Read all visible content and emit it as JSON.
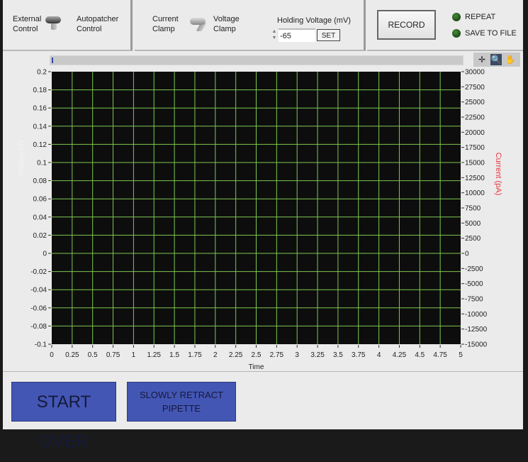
{
  "control_mode": {
    "left_label": "External\nControl",
    "left_line1": "External",
    "left_line2": "Control",
    "right_line1": "Autopatcher",
    "right_line2": "Control",
    "state": "External Control"
  },
  "clamp_mode": {
    "left_line1": "Current",
    "left_line2": "Clamp",
    "right_line1": "Voltage",
    "right_line2": "Clamp",
    "state": "Voltage Clamp"
  },
  "holding_voltage": {
    "label": "Holding Voltage (mV)",
    "value": "-65",
    "set_label": "SET"
  },
  "record": {
    "label": "RECORD"
  },
  "indicators": [
    {
      "label": "REPEAT",
      "state": "off",
      "color": "#2e6b22"
    },
    {
      "label": "SAVE TO FILE",
      "state": "off",
      "color": "#2e6b22"
    }
  ],
  "graph_palette": [
    {
      "icon": "cursor-crosshair-icon",
      "glyph": "✛"
    },
    {
      "icon": "zoom-icon",
      "glyph": "🔍"
    },
    {
      "icon": "pan-hand-icon",
      "glyph": "✋"
    }
  ],
  "buttons": {
    "start_over": "START OVER",
    "retract_line1": "SLOWLY RETRACT",
    "retract_line2": "PIPETTE"
  },
  "colors": {
    "plot_bg": "#0d0d0d",
    "grid": "#7ec850",
    "current_axis_label": "#e8323c",
    "button_blue": "#4356b4"
  },
  "chart_data": {
    "type": "line",
    "title": "",
    "xlabel": "Time",
    "ylabel": "Voltage (V)",
    "y2label": "Current (pA)",
    "xlim": [
      0,
      5
    ],
    "ylim": [
      -0.1,
      0.2
    ],
    "y2lim": [
      -15000,
      30000
    ],
    "grid": true,
    "x_ticks": [
      "0",
      "0.25",
      "0.5",
      "0.75",
      "1",
      "1.25",
      "1.5",
      "1.75",
      "2",
      "2.25",
      "2.5",
      "2.75",
      "3",
      "3.25",
      "3.5",
      "3.75",
      "4",
      "4.25",
      "4.5",
      "4.75",
      "5"
    ],
    "y_ticks": [
      "0.2",
      "0.18",
      "0.16",
      "0.14",
      "0.12",
      "0.1",
      "0.08",
      "0.06",
      "0.04",
      "0.02",
      "0",
      "-0.02",
      "-0.04",
      "-0.06",
      "-0.08",
      "-0.1"
    ],
    "y2_ticks": [
      "30000",
      "27500",
      "25000",
      "22500",
      "20000",
      "17500",
      "15000",
      "12500",
      "10000",
      "7500",
      "5000",
      "2500",
      "0",
      "-2500",
      "-5000",
      "-7500",
      "-10000",
      "-12500",
      "-15000"
    ],
    "series": []
  }
}
